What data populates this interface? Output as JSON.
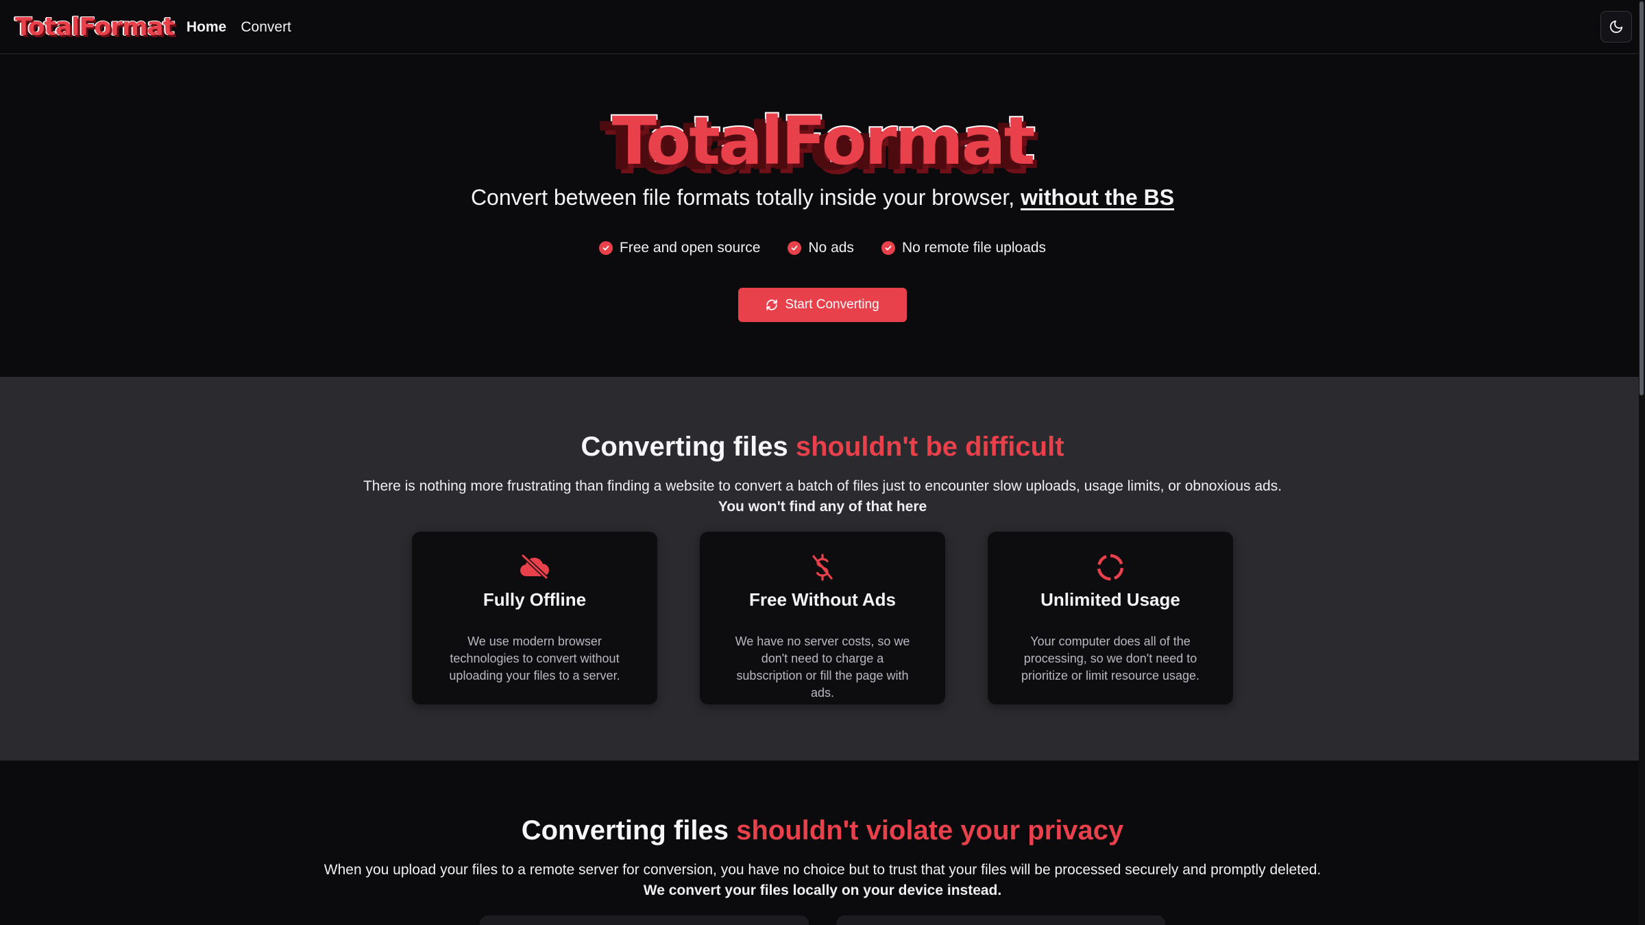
{
  "nav": {
    "logo": "TotalFormat",
    "links": [
      "Home",
      "Convert"
    ],
    "theme_toggle_icon": "moon-icon"
  },
  "hero": {
    "logo": "TotalFormat",
    "subtitle": "Convert between file formats totally inside your browser,",
    "subtitle_link": "without the BS",
    "checks": [
      "Free and open source",
      "No ads",
      "No remote file uploads"
    ],
    "cta_label": "Start Converting",
    "cta_icon": "refresh-icon"
  },
  "features": {
    "title_plain": "Converting files",
    "title_accent": "shouldn't be difficult",
    "description": "There is nothing more frustrating than finding a website to convert a batch of files just to encounter slow uploads, usage limits, or obnoxious ads.",
    "description_bold": "You won't find any of that here",
    "cards": [
      {
        "icon": "cloud-off-icon",
        "title": "Fully Offline",
        "text": "We use modern browser technologies to convert without uploading your files to a server."
      },
      {
        "icon": "dollar-off-icon",
        "title": "Free Without Ads",
        "text": "We have no server costs, so we don't need to charge a subscription or fill the page with ads."
      },
      {
        "icon": "loader-icon",
        "title": "Unlimited Usage",
        "text": "Your computer does all of the processing, so we don't need to prioritize or limit resource usage."
      }
    ]
  },
  "privacy": {
    "title_plain": "Converting files",
    "title_accent": "shouldn't violate your privacy",
    "description": "When you upload your files to a remote server for conversion, you have no choice but to trust that your files will be processed securely and promptly deleted.",
    "description_bold": "We convert your files locally on your device instead."
  },
  "colors": {
    "accent": "#e8414b",
    "background": "#0b0b0e",
    "section_gray": "#2a2a2f",
    "card": "#0d0d10"
  }
}
